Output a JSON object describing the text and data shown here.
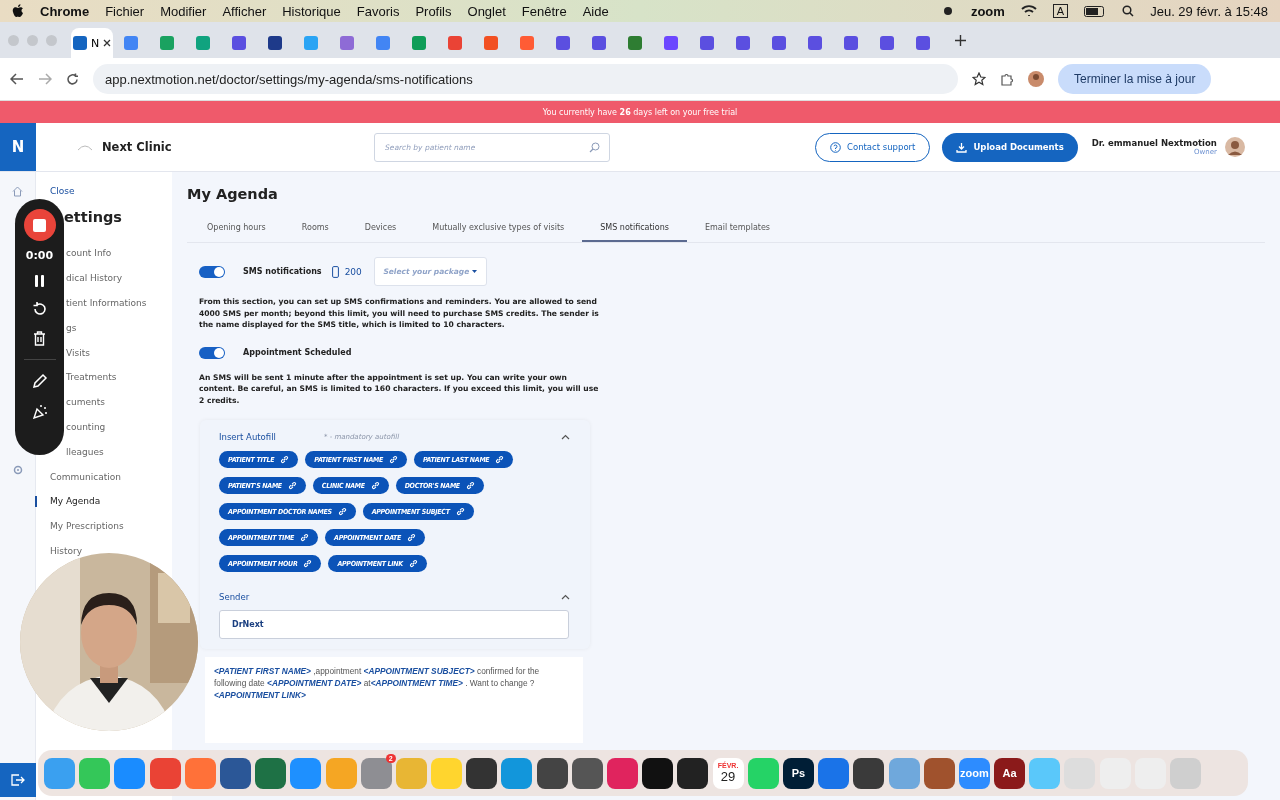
{
  "menubar": {
    "app": "Chrome",
    "menus": [
      "Fichier",
      "Modifier",
      "Afficher",
      "Historique",
      "Favoris",
      "Profils",
      "Onglet",
      "Fenêtre",
      "Aide"
    ],
    "zoom_label": "zoom",
    "input_label": "A",
    "clock": "Jeu. 29 févr. à 15:48"
  },
  "browser": {
    "tabs": [
      {
        "title": "N",
        "selected": true,
        "color": "#1565c0"
      },
      {
        "selected": false,
        "color": "#4285f4"
      },
      {
        "selected": false,
        "color": "#1aa260"
      },
      {
        "selected": false,
        "color": "#10a37f"
      },
      {
        "selected": false,
        "color": "#5b4fe0"
      },
      {
        "selected": false,
        "color": "#1e3a8a"
      },
      {
        "selected": false,
        "color": "#2aa4f4"
      },
      {
        "selected": false,
        "color": "#8e6bd6"
      },
      {
        "selected": false,
        "color": "#4285f4"
      },
      {
        "selected": false,
        "color": "#0f9d58"
      },
      {
        "selected": false,
        "color": "#ea4335"
      },
      {
        "selected": false,
        "color": "#f25022"
      },
      {
        "selected": false,
        "color": "#ff5c35"
      },
      {
        "selected": false,
        "color": "#5b4fe0"
      },
      {
        "selected": false,
        "color": "#5b4fe0"
      },
      {
        "selected": false,
        "color": "#2e7d32"
      },
      {
        "selected": false,
        "color": "#6c47ff"
      },
      {
        "selected": false,
        "color": "#5b4fe0"
      },
      {
        "selected": false,
        "color": "#5b4fe0"
      },
      {
        "selected": false,
        "color": "#5b4fe0"
      },
      {
        "selected": false,
        "color": "#5b4fe0"
      },
      {
        "selected": false,
        "color": "#5b4fe0"
      },
      {
        "selected": false,
        "color": "#5b4fe0"
      },
      {
        "selected": false,
        "color": "#5b4fe0"
      }
    ],
    "url": "app.nextmotion.net/doctor/settings/my-agenda/sms-notifications",
    "update_button": "Terminer la mise à jour"
  },
  "banner": "You currently have **26** days left on your free trial",
  "header": {
    "logo": "N",
    "clinic": "Next Clinic",
    "search_placeholder": "Search by patient name",
    "contact": "Contact support",
    "upload": "Upload Documents",
    "user": "Dr. emmanuel Nextmotion",
    "role": "Owner"
  },
  "sidebar": {
    "close": "Close",
    "title": "ettings",
    "items": [
      {
        "label": "count Info",
        "partial": true,
        "selected": false
      },
      {
        "label": "dical History",
        "partial": true,
        "selected": false
      },
      {
        "label": "tient Informations",
        "partial": true,
        "selected": false
      },
      {
        "label": "gs",
        "partial": true,
        "selected": false
      },
      {
        "label": "Visits",
        "partial": true,
        "selected": false
      },
      {
        "label": "Treatments",
        "partial": true,
        "selected": false
      },
      {
        "label": "cuments",
        "partial": true,
        "selected": false
      },
      {
        "label": "counting",
        "partial": true,
        "selected": false
      },
      {
        "label": "lleagues",
        "partial": true,
        "selected": false
      },
      {
        "label": "Communication",
        "partial": false,
        "selected": false
      },
      {
        "label": "My Agenda",
        "partial": false,
        "selected": true
      },
      {
        "label": "My Prescriptions",
        "partial": false,
        "selected": false
      },
      {
        "label": "History",
        "partial": false,
        "selected": false
      }
    ]
  },
  "page": {
    "title": "My Agenda",
    "tabs": [
      {
        "label": "Opening hours",
        "selected": false
      },
      {
        "label": "Rooms",
        "selected": false
      },
      {
        "label": "Devices",
        "selected": false
      },
      {
        "label": "Mutually exclusive types of visits",
        "selected": false
      },
      {
        "label": "SMS notifications",
        "selected": true
      },
      {
        "label": "Email templates",
        "selected": false
      }
    ],
    "sms": {
      "on": true,
      "label": "SMS notifications",
      "credits": "200",
      "package_placeholder": "Select your package"
    },
    "intro": "From this section, you can set up SMS confirmations and reminders. You are allowed to send 4000 SMS per month; beyond this limit, you will need to purchase SMS credits. The sender is the name displayed for the SMS title, which is limited to 10 characters.",
    "scheduled": {
      "on": true,
      "label": "Appointment Scheduled"
    },
    "note": "An SMS will be sent 1 minute after the appointment is set up. You can write your own content. Be careful, an SMS is limited to 160 characters. If you exceed this limit, you will use 2 credits.",
    "autofill": {
      "title": "Insert Autofill",
      "hint": "* - mandatory autofill",
      "expanded": true,
      "chips": [
        [
          "PATIENT TITLE",
          "PATIENT FIRST NAME",
          "PATIENT LAST NAME"
        ],
        [
          "PATIENT'S NAME",
          "CLINIC NAME",
          "DOCTOR'S NAME"
        ],
        [
          "APPOINTMENT DOCTOR NAMES",
          "APPOINTMENT SUBJECT"
        ],
        [
          "APPOINTMENT TIME",
          "APPOINTMENT DATE"
        ],
        [
          "APPOINTMENT HOUR",
          "APPOINTMENT LINK"
        ]
      ]
    },
    "sender": {
      "title": "Sender",
      "expanded": true,
      "value": "DrNext"
    },
    "message": [
      {
        "kind": "tag",
        "text": "<PATIENT FIRST NAME>"
      },
      {
        "kind": "text",
        "text": " ,appointment "
      },
      {
        "kind": "tag",
        "text": "<APPOINTMENT SUBJECT>"
      },
      {
        "kind": "text",
        "text": "  confirmed for the following date "
      },
      {
        "kind": "tag",
        "text": "<APPOINTMENT DATE>"
      },
      {
        "kind": "text",
        "text": "  at"
      },
      {
        "kind": "tag",
        "text": "<APPOINTMENT TIME>"
      },
      {
        "kind": "text",
        "text": " . Want to change ? "
      },
      {
        "kind": "tag",
        "text": "<APPOINTMENT LINK>"
      }
    ]
  },
  "recorder": {
    "time": "0:00"
  },
  "dock": [
    {
      "color": "#3aa0f0"
    },
    {
      "color": "#34c759"
    },
    {
      "color": "#1a8cff"
    },
    {
      "color": "#ea4335"
    },
    {
      "color": "#ff7139"
    },
    {
      "color": "#2b5797"
    },
    {
      "color": "#1e7145"
    },
    {
      "color": "#1e90ff"
    },
    {
      "color": "#f5a623"
    },
    {
      "color": "#8e8e93",
      "badge": "2"
    },
    {
      "color": "#e8b634"
    },
    {
      "color": "#ffd52e"
    },
    {
      "color": "#333333"
    },
    {
      "color": "#1296db"
    },
    {
      "color": "#444444"
    },
    {
      "color": "#555555"
    },
    {
      "color": "#e0245e"
    },
    {
      "color": "#111111"
    },
    {
      "color": "#222222"
    },
    {
      "color": "#ffffff",
      "month": "FÉVR.",
      "label": "29"
    },
    {
      "color": "#25d366"
    },
    {
      "color": "#001e36",
      "label": "Ps"
    },
    {
      "color": "#1a73e8"
    },
    {
      "color": "#3a3a3a"
    },
    {
      "color": "#6fa8dc"
    },
    {
      "color": "#a0522d"
    },
    {
      "color": "#2d8cff",
      "label": "zoom"
    },
    {
      "color": "#8b1a1a",
      "label": "Aa"
    },
    {
      "color": "#5ac8fa"
    },
    {
      "color": "#dddddd"
    },
    {
      "color": "#eeeeee"
    },
    {
      "color": "#eeeeee"
    },
    {
      "color": "#cfcfcf"
    }
  ]
}
